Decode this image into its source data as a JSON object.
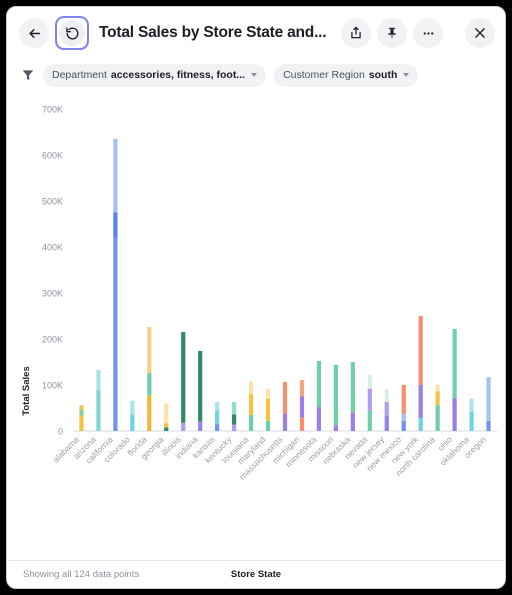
{
  "header": {
    "back_label": "back-arrow",
    "refresh_label": "refresh",
    "title": "Total Sales by Store State and...",
    "share_label": "share",
    "pin_label": "pin",
    "more_label": "more-options",
    "close_label": "close"
  },
  "filters": {
    "funnel_label": "filter",
    "items": [
      {
        "name": "Department",
        "value": "accessories, fitness, foot...",
        "has_caret": true
      },
      {
        "name": "Customer Region",
        "value": "south",
        "has_caret": true
      }
    ]
  },
  "footer": {
    "count_text": "Showing all 124 data points",
    "x_axis_title": "Store State"
  },
  "colors": {
    "accent": "#7b83ef",
    "text": "#1b1e25",
    "muted": "#8e949f",
    "chip_bg": "#f1f2f4",
    "grid": "#e8eaed"
  },
  "chart_data": {
    "type": "bar",
    "stacked": true,
    "title": "Total Sales by Store State and...",
    "xlabel": "Store State",
    "ylabel": "Total Sales",
    "ylim": [
      0,
      700000
    ],
    "yticks": [
      0,
      100000,
      200000,
      300000,
      400000,
      500000,
      600000,
      700000
    ],
    "ytick_labels": [
      "0",
      "100K",
      "200K",
      "300K",
      "400K",
      "500K",
      "600K",
      "700K"
    ],
    "grid": false,
    "legend": "none",
    "categories": [
      "alabama",
      "arizona",
      "california",
      "colorado",
      "florida",
      "georgia",
      "illinois",
      "indiana",
      "kansas",
      "kentucky",
      "louisiana",
      "maryland",
      "massachusetts",
      "michigan",
      "minnesota",
      "missouri",
      "nebraska",
      "nevada",
      "new jersey",
      "new mexico",
      "new york",
      "north carolina",
      "ohio",
      "oklahoma",
      "oregon"
    ],
    "bar_colors": [
      "#f5c344",
      "#7fd4d4",
      "#6f95ef",
      "#6fd4e0",
      "#f0b63c",
      "#2e8b63",
      "#f7cf5e",
      "#2e8b63",
      "#8b6fd4",
      "#f5c344",
      "#f58f6f",
      "#9b7fe8",
      "#6fcfa8",
      "#6fcfa8",
      "#9b7fe8",
      "#b39cf0",
      "#f5a583",
      "#6f95ef",
      "#f58f6f",
      "#f5c344",
      "#f58f6f",
      "#6fcfa8",
      "#6fcfa8",
      "#6fd4e0",
      "#9ec5f5"
    ],
    "bars": [
      {
        "state": "alabama",
        "segments": [
          {
            "color": "#f5c344",
            "value": 33000
          },
          {
            "color": "#8fcf8f",
            "value": 14000
          },
          {
            "color": "#f5c344",
            "value": 9000
          }
        ],
        "total": 56000
      },
      {
        "state": "arizona",
        "segments": [
          {
            "color": "#7fd4d4",
            "value": 88000
          },
          {
            "color": "#a8e4e4",
            "value": 45000
          }
        ],
        "total": 133000
      },
      {
        "state": "california",
        "segments": [
          {
            "color": "#6f95ef",
            "value": 420000
          },
          {
            "color": "#5b82e0",
            "value": 55000
          },
          {
            "color": "#a8bef5",
            "value": 160000
          }
        ],
        "total": 635000
      },
      {
        "state": "colorado",
        "segments": [
          {
            "color": "#6fd4e0",
            "value": 36000
          },
          {
            "color": "#a8e4ee",
            "value": 30000
          }
        ],
        "total": 66000
      },
      {
        "state": "florida",
        "segments": [
          {
            "color": "#f0b63c",
            "value": 78000
          },
          {
            "color": "#6fcfa8",
            "value": 48000
          },
          {
            "color": "#f5d08a",
            "value": 100000
          }
        ],
        "total": 226000
      },
      {
        "state": "georgia",
        "segments": [
          {
            "color": "#2e8b63",
            "value": 8000
          },
          {
            "color": "#f5c344",
            "value": 9000
          },
          {
            "color": "#fbe2a8",
            "value": 43000
          }
        ],
        "total": 60000
      },
      {
        "state": "illinois",
        "segments": [
          {
            "color": "#b39cf0",
            "value": 18000
          },
          {
            "color": "#2e8b63",
            "value": 197000
          }
        ],
        "total": 215000
      },
      {
        "state": "indiana",
        "segments": [
          {
            "color": "#9b7fe8",
            "value": 21000
          },
          {
            "color": "#2e8b63",
            "value": 153000
          }
        ],
        "total": 174000
      },
      {
        "state": "kansas",
        "segments": [
          {
            "color": "#6f95ef",
            "value": 15000
          },
          {
            "color": "#6fd4e0",
            "value": 30000
          },
          {
            "color": "#a8e4ee",
            "value": 18000
          }
        ],
        "total": 63000
      },
      {
        "state": "kentucky",
        "segments": [
          {
            "color": "#b39cf0",
            "value": 14000
          },
          {
            "color": "#2e8b63",
            "value": 22000
          },
          {
            "color": "#8fe0c0",
            "value": 27000
          }
        ],
        "total": 63000
      },
      {
        "state": "louisiana",
        "segments": [
          {
            "color": "#6fcfa8",
            "value": 35000
          },
          {
            "color": "#f5c344",
            "value": 45000
          },
          {
            "color": "#fbe2a8",
            "value": 28000
          }
        ],
        "total": 108000
      },
      {
        "state": "maryland",
        "segments": [
          {
            "color": "#6fcfa8",
            "value": 22000
          },
          {
            "color": "#f5c344",
            "value": 48000
          },
          {
            "color": "#fbe2a8",
            "value": 22000
          }
        ],
        "total": 92000
      },
      {
        "state": "massachusetts",
        "segments": [
          {
            "color": "#9b7fe8",
            "value": 37000
          },
          {
            "color": "#f58f6f",
            "value": 70000
          }
        ],
        "total": 107000
      },
      {
        "state": "michigan",
        "segments": [
          {
            "color": "#f58f6f",
            "value": 30000
          },
          {
            "color": "#9b7fe8",
            "value": 45000
          },
          {
            "color": "#f5a583",
            "value": 36000
          }
        ],
        "total": 111000
      },
      {
        "state": "minnesota",
        "segments": [
          {
            "color": "#9b7fe8",
            "value": 52000
          },
          {
            "color": "#6fcfa8",
            "value": 100000
          }
        ],
        "total": 152000
      },
      {
        "state": "missouri",
        "segments": [
          {
            "color": "#9b7fe8",
            "value": 12000
          },
          {
            "color": "#6fcfa8",
            "value": 132000
          }
        ],
        "total": 144000
      },
      {
        "state": "nebraska",
        "segments": [
          {
            "color": "#9b7fe8",
            "value": 40000
          },
          {
            "color": "#6fcfa8",
            "value": 110000
          }
        ],
        "total": 150000
      },
      {
        "state": "nevada",
        "segments": [
          {
            "color": "#6fcfa8",
            "value": 44000
          },
          {
            "color": "#b39cf0",
            "value": 48000
          },
          {
            "color": "#d8f0e4",
            "value": 30000
          }
        ],
        "total": 122000
      },
      {
        "state": "new jersey",
        "segments": [
          {
            "color": "#9b7fe8",
            "value": 33000
          },
          {
            "color": "#b39cf0",
            "value": 30000
          },
          {
            "color": "#d8f0e4",
            "value": 28000
          }
        ],
        "total": 91000
      },
      {
        "state": "new mexico",
        "segments": [
          {
            "color": "#6f95ef",
            "value": 22000
          },
          {
            "color": "#9ec5f5",
            "value": 16000
          },
          {
            "color": "#f58f6f",
            "value": 62000
          }
        ],
        "total": 100000
      },
      {
        "state": "new york",
        "segments": [
          {
            "color": "#6fd4e0",
            "value": 28000
          },
          {
            "color": "#9b7fe8",
            "value": 72000
          },
          {
            "color": "#f58f6f",
            "value": 150000
          }
        ],
        "total": 250000
      },
      {
        "state": "north carolina",
        "segments": [
          {
            "color": "#6fcfa8",
            "value": 56000
          },
          {
            "color": "#f5c344",
            "value": 30000
          },
          {
            "color": "#fbe2a8",
            "value": 14000
          }
        ],
        "total": 100000
      },
      {
        "state": "ohio",
        "segments": [
          {
            "color": "#9b7fe8",
            "value": 72000
          },
          {
            "color": "#6fcfa8",
            "value": 150000
          }
        ],
        "total": 222000
      },
      {
        "state": "oklahoma",
        "segments": [
          {
            "color": "#6fd4e0",
            "value": 42000
          },
          {
            "color": "#a8e4ee",
            "value": 28000
          }
        ],
        "total": 70000
      },
      {
        "state": "oregon",
        "segments": [
          {
            "color": "#6f95ef",
            "value": 22000
          },
          {
            "color": "#9ec5f5",
            "value": 95000
          }
        ],
        "total": 117000
      }
    ]
  }
}
